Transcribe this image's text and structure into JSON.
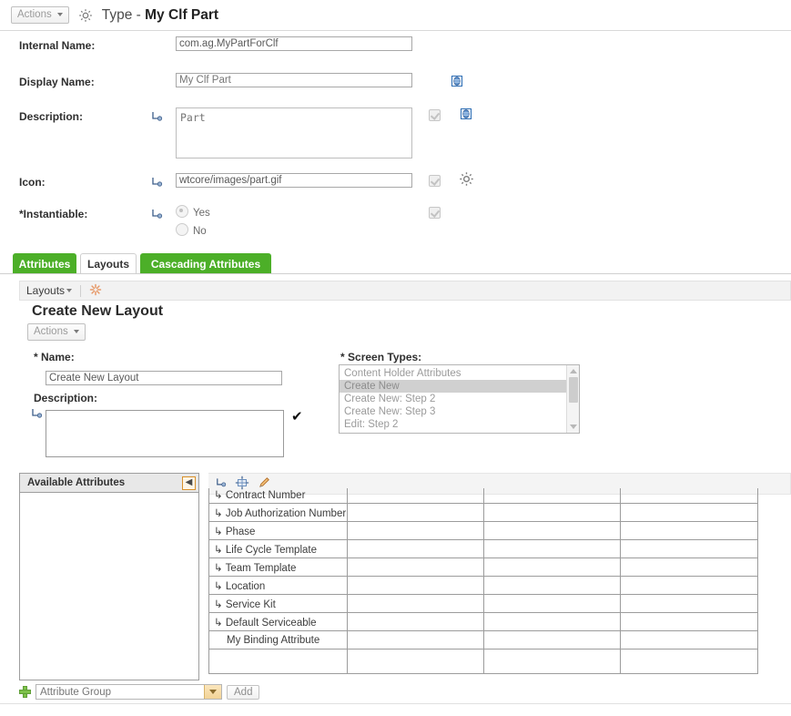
{
  "header": {
    "actions_label": "Actions",
    "gear_icon": "gear-icon",
    "title_prefix": "Type - ",
    "title_value": "My Clf Part"
  },
  "form": {
    "rows": [
      {
        "label": "Internal Name:",
        "value": "com.ag.MyPartForClf",
        "placeholder": "",
        "has_inherit": false,
        "has_checkbox": false,
        "has_side_icon": false
      },
      {
        "label": "Display Name:",
        "value": "",
        "placeholder": "My Clf Part",
        "has_inherit": false,
        "has_checkbox": false,
        "has_side_icon": true,
        "side_icon": "translate-icon"
      },
      {
        "label": "Description:",
        "value": "",
        "placeholder": "Part",
        "has_inherit": true,
        "has_checkbox": true,
        "has_side_icon": true,
        "side_icon": "translate-icon"
      },
      {
        "label": "Icon:",
        "value": "wtcore/images/part.gif",
        "placeholder": "",
        "has_inherit": true,
        "has_checkbox": true,
        "has_side_icon": true,
        "side_icon": "gear-icon"
      }
    ],
    "instantiable": {
      "label": "Instantiable:",
      "required_marker": "*",
      "options": [
        {
          "label": "Yes",
          "selected": true
        },
        {
          "label": "No",
          "selected": false
        }
      ]
    }
  },
  "tabs": [
    {
      "label": "Attributes",
      "active": false
    },
    {
      "label": "Layouts",
      "active": true
    },
    {
      "label": "Cascading Attributes",
      "active": false
    }
  ],
  "subbar": {
    "menu_label": "Layouts",
    "refresh_icon": "refresh-starburst-icon"
  },
  "layout_section": {
    "title": "Create New Layout",
    "actions_label": "Actions",
    "name_label": "Name:",
    "name_required": "*",
    "name_value": "Create New Layout",
    "description_label": "Description:",
    "description_value": "",
    "screen_types_label": "Screen Types:",
    "screen_types_required": "*",
    "screen_types": [
      {
        "label": "Content Holder Attributes",
        "selected": false
      },
      {
        "label": "Create New",
        "selected": true
      },
      {
        "label": "Create New: Step 2",
        "selected": false
      },
      {
        "label": "Create New: Step 3",
        "selected": false
      },
      {
        "label": "Edit: Step 2",
        "selected": false
      }
    ]
  },
  "available_attributes": {
    "title": "Available Attributes",
    "collapse_icon": "chevron-left-icon",
    "items": []
  },
  "grid_toolbar": {
    "inherit_icon": "inherited-attribute-icon",
    "resize_icon": "resize-columns-icon",
    "edit_icon": "pencil-edit-icon"
  },
  "grid": {
    "rows": [
      {
        "label": "Contract Number",
        "inherited": true,
        "clipped": true
      },
      {
        "label": "Job Authorization Number",
        "inherited": true,
        "clipped": false
      },
      {
        "label": "Phase",
        "inherited": true,
        "clipped": false
      },
      {
        "label": "Life Cycle Template",
        "inherited": true,
        "clipped": false
      },
      {
        "label": "Team Template",
        "inherited": true,
        "clipped": false
      },
      {
        "label": "Location",
        "inherited": true,
        "clipped": false
      },
      {
        "label": "Service Kit",
        "inherited": true,
        "clipped": false
      },
      {
        "label": "Default Serviceable",
        "inherited": true,
        "clipped": false
      },
      {
        "label": "My Binding Attribute",
        "inherited": false,
        "clipped": false
      },
      {
        "label": "",
        "inherited": false,
        "clipped": false
      }
    ],
    "column_count": 4
  },
  "bottom": {
    "add_icon": "plus-icon",
    "group_placeholder": "Attribute Group",
    "group_value": "",
    "dropdown_icon": "chevron-down-icon",
    "add_label": "Add"
  },
  "colors": {
    "tab_green": "#4caf28",
    "accent_orange": "#d9902a",
    "link_blue": "#2f6fb5",
    "border_gray": "#9c9c9c"
  }
}
